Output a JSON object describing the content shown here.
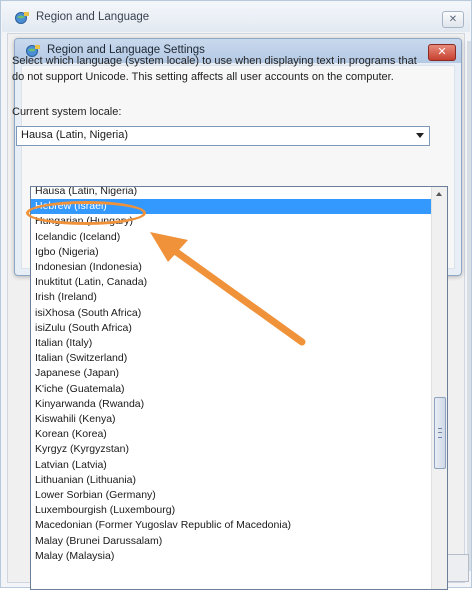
{
  "outer_window": {
    "title": "Region and Language",
    "close_glyph": "✕"
  },
  "dialog": {
    "title": "Region and Language Settings",
    "close_glyph": "✕",
    "description": "Select which language (system locale) to use when displaying text in programs that do not support Unicode. This setting affects all user accounts on the computer.",
    "locale_label": "Current system locale:",
    "locale_value": "Hausa (Latin, Nigeria)"
  },
  "dropdown": {
    "items": [
      "Hausa (Latin, Nigeria)",
      "Hebrew (Israel)",
      "Hungarian (Hungary)",
      "Icelandic (Iceland)",
      "Igbo (Nigeria)",
      "Indonesian (Indonesia)",
      "Inuktitut (Latin, Canada)",
      "Irish (Ireland)",
      "isiXhosa (South Africa)",
      "isiZulu (South Africa)",
      "Italian (Italy)",
      "Italian (Switzerland)",
      "Japanese (Japan)",
      "K'iche (Guatemala)",
      "Kinyarwanda (Rwanda)",
      "Kiswahili (Kenya)",
      "Korean (Korea)",
      "Kyrgyz (Kyrgyzstan)",
      "Latvian (Latvia)",
      "Lithuanian (Lithuania)",
      "Lower Sorbian (Germany)",
      "Luxembourgish (Luxembourg)",
      "Macedonian (Former Yugoslav Republic of Macedonia)",
      "Malay (Brunei Darussalam)",
      "Malay (Malaysia)"
    ],
    "selected_index": 1
  },
  "icons": {
    "window_icon": "region-globe-icon",
    "callout": "orange-arrow-annotation"
  },
  "colors": {
    "selection": "#3399ff",
    "callout": "#f0923a",
    "close_button": "#c7402f"
  }
}
